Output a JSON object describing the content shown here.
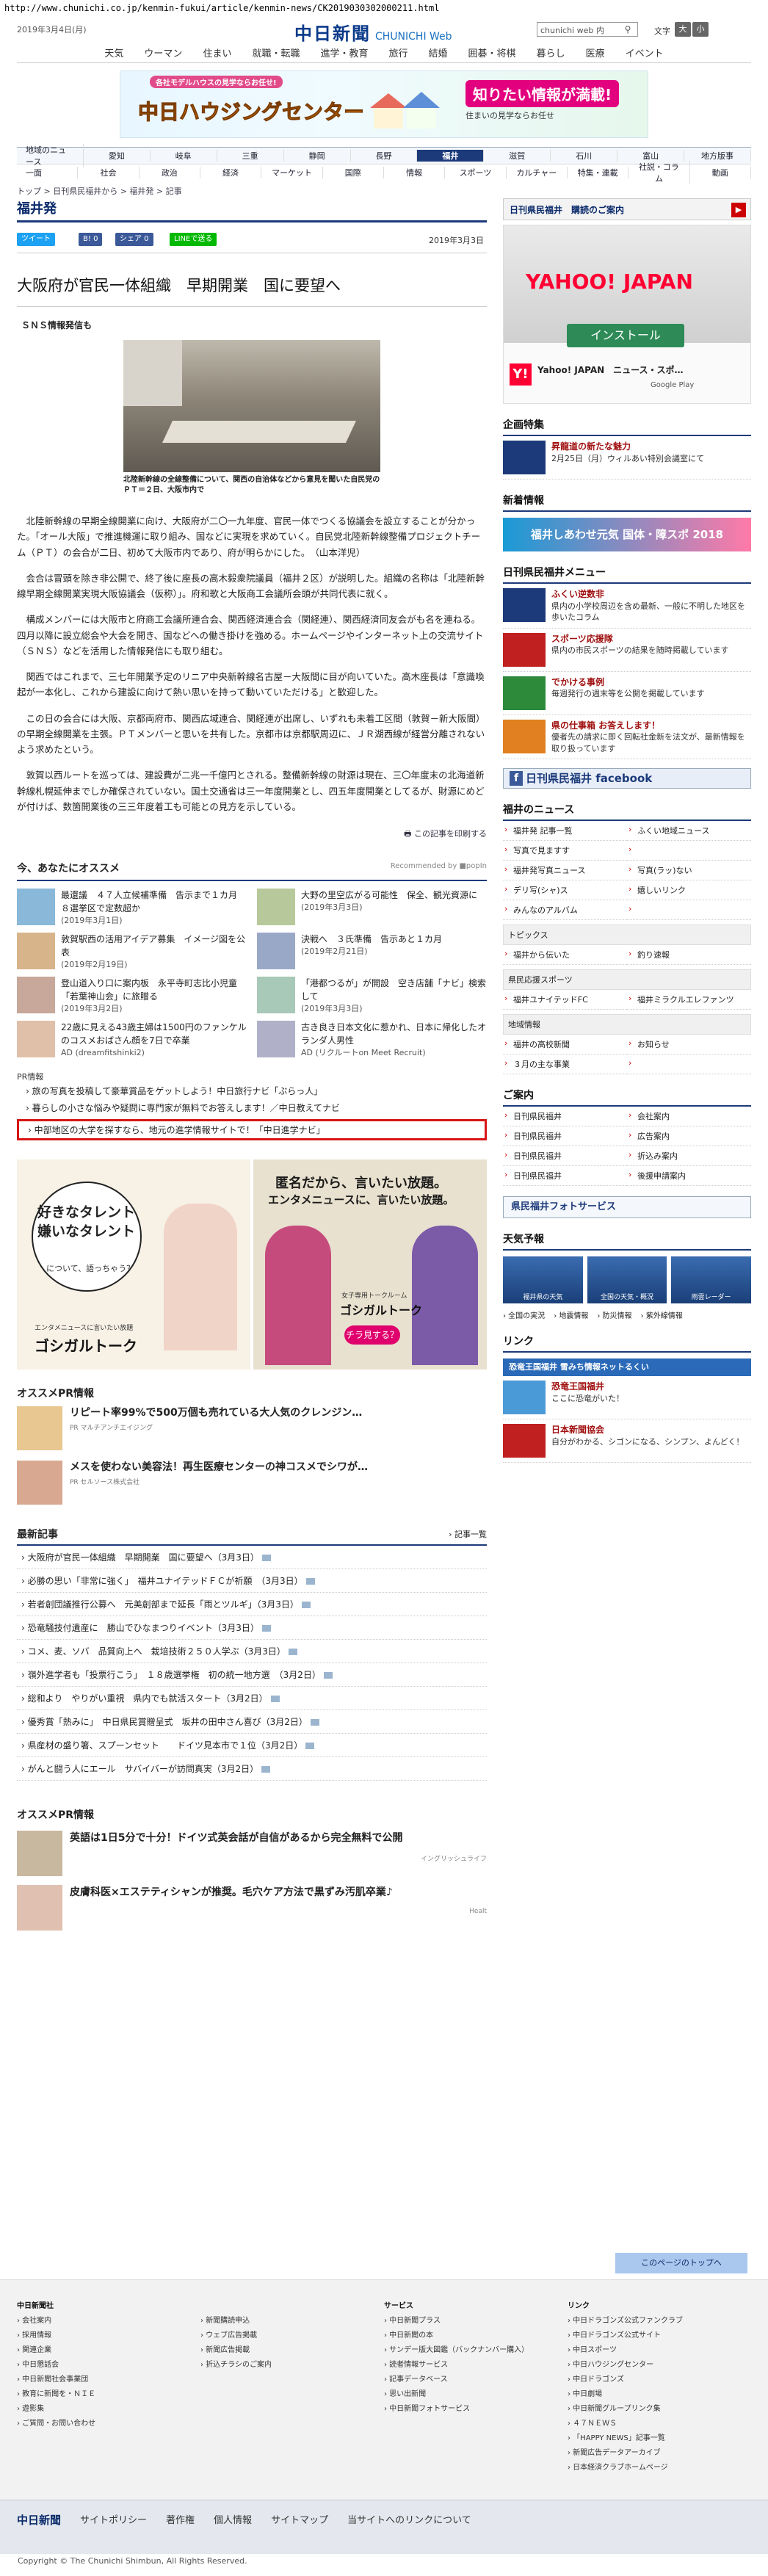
{
  "url": "http://www.chunichi.co.jp/kenmin-fukui/article/kenmin-news/CK2019030302000211.html",
  "header": {
    "date": "2019年3月4日(月)",
    "logo": "中日新聞",
    "logo_web": "CHUNICHI Web",
    "search_placeholder": "chunichi web 内",
    "text_size_label": "文字",
    "text_size_large": "大",
    "text_size_small": "小"
  },
  "category_nav": [
    "天気",
    "ウーマン",
    "住まい",
    "就職・転職",
    "進学・教育",
    "旅行",
    "結婚",
    "囲碁・将棋",
    "暮らし",
    "医療",
    "イベント"
  ],
  "banner": {
    "subtitle": "各社モデルハウスの見学ならお任せ!",
    "title": "中日ハウジングセンター",
    "badge": "知りたい情報が満載!",
    "note": "住まいの見学ならお任せ"
  },
  "region_nav": {
    "row1": [
      "地域のニュース",
      "愛知",
      "岐阜",
      "三重",
      "静岡",
      "長野",
      "福井",
      "滋賀",
      "石川",
      "富山",
      "地方版事"
    ],
    "row1_selected": "福井",
    "row2": [
      "一面",
      "社会",
      "政治",
      "経済",
      "マーケット",
      "国際",
      "情報",
      "スポーツ",
      "カルチャー",
      "特集・連載",
      "社説・コラム",
      "動画"
    ]
  },
  "breadcrumb": "トップ > 日刊県民福井から > 福井発 > 記事",
  "section_title": "福井発",
  "share": {
    "tweet": "ツイート",
    "like": "0",
    "share": "シェア 0",
    "line": "LINEで送る"
  },
  "article": {
    "date": "2019年3月3日",
    "title": "大阪府が官民一体組織　早期開業　国に要望へ",
    "lead": "ＳＮＳ情報発信も",
    "caption": "北陸新幹線の全線整備について、関西の自治体などから意見を聞いた自民党のＰＴ＝２日、大阪市内で",
    "paragraphs": [
      "北陸新幹線の早期全線開業に向け、大阪府が二〇一九年度、官民一体でつくる協議会を設立することが分かった。「オール大阪」で推進機運に取り組み、国などに実現を求めていく。自民党北陸新幹線整備プロジェクトチーム（ＰＴ）の会合が二日、初めて大阪市内であり、府が明らかにした。　（山本洋児）",
      "会合は冒頭を除き非公開で、終了後に座長の高木毅衆院議員（福井２区）が説明した。組織の名称は「北陸新幹線早期全線開業実現大阪協議会（仮称）」。府和歌と大阪商工会議所会頭が共同代表に就く。",
      "構成メンバーには大阪市と府商工会議所連合会、関西経済連合会（関経連）、関西経済同友会がも名を連ねる。四月以降に設立総会や大会を開き、国などへの働き掛けを強める。ホームページやインターネット上の交流サイト（ＳＮＳ）などを活用した情報発信にも取り組む。",
      "関西ではこれまで、三七年開業予定のリニア中央新幹線名古屋－大阪間に目が向いていた。高木座長は「意識喚起が一本化し、これから建設に向けて熱い思いを持って動いていただける」と歓迎した。",
      "この日の会合には大阪、京都両府市、関西広域連合、関経連が出席し、いずれも未着工区間（敦賀－新大阪間）の早期全線開業を主張。ＰＴメンバーと思いを共有した。京都市は京都駅周辺に、ＪＲ湖西線が経営分離されないよう求めたという。",
      "敦賀以西ルートを巡っては、建設費が二兆一千億円とされる。整備新幹線の財源は現在、三〇年度末の北海道新幹線札幌延伸までしか確保されていない。国土交通省は三一年度開業とし、四五年度開業としてるが、財源にめどが付けば、数箇開業後の三三年度着工も可能との見方を示している。"
    ],
    "print_link": "この記事を印刷する"
  },
  "recommend": {
    "title": "今、あなたにオススメ",
    "by": "Recommended by ■popIn",
    "items": [
      {
        "title": "最還議　４７人立候補準備　告示まで１カ月　８選挙区で定数超か",
        "meta": "(2019年3月1日)"
      },
      {
        "title": "大野の里空広がる可能性　保全、観光資源に",
        "meta": "(2019年3月3日)"
      },
      {
        "title": "敦賀駅西の活用アイデア募集　イメージ図を公表",
        "meta": "(2019年2月19日)"
      },
      {
        "title": "決戦へ　３氏準備　告示あと１カ月",
        "meta": "(2019年2月21日)"
      },
      {
        "title": "登山道入り口に案内板　永平寺町志比小児童「若葉神山会」に旅贈る",
        "meta": "(2019年3月2日)"
      },
      {
        "title": "「港都つるが」が開設　空き店舗「ナビ」検索して",
        "meta": "(2019年3月3日)"
      },
      {
        "title": "22歳に見える43歳主婦は1500円のファンケルのコスメおばさん顔を7日で卒業",
        "meta": "AD (dreamfitshinki2)"
      },
      {
        "title": "古き良き日本文化に惹かれ、日本に帰化したオランダ人男性",
        "meta": "AD (リクルートon Meet Recruit)"
      }
    ]
  },
  "pr": {
    "label": "PR情報",
    "lines": [
      "旅の写真を投稿して豪華賞品をゲットしよう！中日旅行ナビ「ぶらっ人」",
      "暮らしの小さな悩みや疑問に専門家が無料でお答えします！／中日教えてナビ",
      "中部地区の大学を探すなら、地元の進学情報サイトで！「中日進学ナビ」"
    ]
  },
  "ad_big": {
    "headline1": "好きなタレント 嫌いなタレント",
    "sub1": "について、語っちゃう？",
    "brand": "ゴシガルトーク",
    "tagline": "エンタメニュースに言いたい放題",
    "headline2": "匿名だから、言いたい放題。",
    "headline2b": "エンタメニュースに、言いたい放題。",
    "cta": "チラ見する？",
    "sub2": "女子専用トークルーム"
  },
  "osusume_pr": {
    "title": "オススメPR情報",
    "items": [
      {
        "title": "リピート率99%で500万個も売れている大人気のクレンジン…",
        "source": "PR マルチアンチエイジング"
      },
      {
        "title": "メスを使わない美容法！再生医療センターの神コスメでシワが…",
        "source": "PR セルソース株式会社"
      }
    ]
  },
  "latest": {
    "title": "最新記事",
    "more": "記事一覧",
    "items": [
      "大阪府が官民一体組織　早期開業　国に要望へ（3月3日）",
      "必勝の思い「非常に強く」　福井ユナイテッドＦＣが祈願　（3月3日）",
      "若者創団議推行公募へ　元美創部まで延長「雨とツルギ」（3月3日）",
      "恐竜騒技付遺産に　勝山でひなまつりイベント（3月3日）",
      "コメ、麦、ソバ　品質向上へ　栽培技術２５０人学ぶ（3月3日）",
      "嶺外進学者も「投票行こう」　１８歳選挙権　初の統一地方選　（3月2日）",
      "総和より　やりがい重視　県内でも就活スタート（3月2日）",
      "優秀賞「熱みに」　中日県民賞贈呈式　坂井の田中さん喜び（3月2日）",
      "県産材の盛り箸、スプーンセット　　ドイツ見本市で１位（3月2日）",
      "がんと闘う人にエール　サバイバーが訪問真実（3月2日）"
    ]
  },
  "osusume_pr2": {
    "title": "オススメPR情報",
    "items": [
      {
        "title": "英語は1日5分で十分！ドイツ式英会話が自信があるから完全無料で公開",
        "source": "イングリッシュライフ"
      },
      {
        "title": "皮膚科医×エステティシャンが推奨。毛穴ケア方法で黒ずみ汚肌卒業♪",
        "source": "Healt"
      }
    ]
  },
  "side": {
    "kenmin_box": "日刊県民福井　購読のご案内",
    "ad": {
      "brand": "YAHOO! JAPAN",
      "install": "インストール",
      "app": "Yahoo! JAPAN　ニュース・スポ…",
      "store": "Google Play"
    },
    "kikaku_title": "企画特集",
    "kikaku_items": [
      {
        "title": "昇龍道の新たな魅力",
        "desc": "2月25日（月）ウィルあい特別会議室にて"
      }
    ],
    "shinchaku_title": "新着情報",
    "shinchaku_banner": "福井しあわせ元気 国体・障スポ 2018",
    "menu_title": "日刊県民福井メニュー",
    "menu_items": [
      {
        "title": "ふくい逆数非",
        "desc": "県内の小学校周辺を含め最新、一般に不明した地区を歩いたコラム"
      },
      {
        "title": "スポーツ応援隊",
        "desc": "県内の市民スポーツの結果を随時掲載しています"
      },
      {
        "title": "でかける事例",
        "desc": "毎週発行の週末等を公開を掲載しています"
      },
      {
        "title": "県の仕事箱 お答えします！",
        "desc": "優者先の請求に即く回転社金新を法文が、最新情報を取り扱っています"
      }
    ],
    "fb": "日刊県民福井 facebook",
    "fukui_news_title": "福井のニュース",
    "fukui_news": [
      {
        "l": "福井発 記事一覧",
        "r": "ふくい地域ニュース"
      },
      {
        "l": "写真で見ますす",
        "r": ""
      },
      {
        "l": "福井発写真ニュース",
        "r": "写真(ラッ)ない"
      },
      {
        "l": "デリ写(シャ)ス",
        "r": "嬉しいリンク"
      },
      {
        "l": "みんなのアルバム",
        "r": ""
      }
    ],
    "topics_group": "トピックス",
    "topics": [
      {
        "l": "福井から伝いた",
        "r": "釣り速報"
      }
    ],
    "sports_group": "県民応援スポーツ",
    "sports": [
      {
        "l": "福井ユナイテッドFC",
        "r": "福井ミラクルエレファンツ"
      }
    ],
    "area_group": "地域情報",
    "area": [
      {
        "l": "福井の高校新聞",
        "r": "お知らせ"
      },
      {
        "l": "３月の主な事業",
        "r": ""
      }
    ],
    "guide_title": "ご案内",
    "guide": [
      {
        "l": "日刊県民福井",
        "r": "会社案内"
      },
      {
        "l": "日刊県民福井",
        "r": "広告案内"
      },
      {
        "l": "日刊県民福井",
        "r": "折込み案内"
      },
      {
        "l": "日刊県民福井",
        "r": "後援申請案内"
      }
    ],
    "photo_bar": "県民福井フォトサービス",
    "weather_title": "天気予報",
    "weather": [
      "福井県の天気",
      "全国の天気・概況",
      "雨雲レーダー"
    ],
    "weather_links": [
      "全国の実況",
      "地震情報",
      "防災情報",
      "紫外線情報"
    ],
    "link_title": "リンク",
    "links": [
      {
        "title": "恐竜王国福井",
        "desc": "ここに恐竜がいた！"
      },
      {
        "title": "日本新聞協会",
        "desc": "自分がわかる、シゴンになる、シンプン、よんどく！"
      }
    ],
    "link_banner": "恐竜王国福井 雪みち情報ネットるくい"
  },
  "footer": {
    "page_top": "このページのトップへ",
    "cols": [
      {
        "head": "中日新聞社",
        "items": [
          "会社案内",
          "採用情報",
          "関連企業",
          "中日懇話会",
          "中日新聞社会事業団",
          "教育に新聞を・ＮＩＥ",
          "遊影集",
          "ご質問・お問い合わせ"
        ]
      },
      {
        "head": "",
        "items": [
          "新聞購読申込",
          "ウェブ広告掲載",
          "新聞広告掲載",
          "折込チラシのご案内"
        ]
      },
      {
        "head": "サービス",
        "items": [
          "中日新聞プラス",
          "中日新聞の本",
          "サンデー版大図鑑（バックナンバー購入）",
          "読者情報サービス",
          "記事データベース",
          "思い出新聞",
          "中日新聞フォトサービス"
        ]
      },
      {
        "head": "リンク",
        "items": [
          "中日ドラゴンズ公式ファンクラブ",
          "中日ドラゴンズ公式サイト",
          "中日スポーツ",
          "中日ハウジングセンター",
          "中日ドラゴンズ",
          "中日劇場",
          "中日新聞グループリンク集",
          "４７ＮＥＷＳ",
          "「HAPPY NEWS」記事一覧",
          "新聞広告データアーカイブ",
          "日本経済クラブホームページ"
        ]
      }
    ],
    "nav": [
      "中日新聞",
      "サイトポリシー",
      "著作権",
      "個人情報",
      "サイトマップ",
      "当サイトへのリンクについて"
    ],
    "copyright": "Copyright © The Chunichi Shimbun, All Rights Reserved."
  }
}
